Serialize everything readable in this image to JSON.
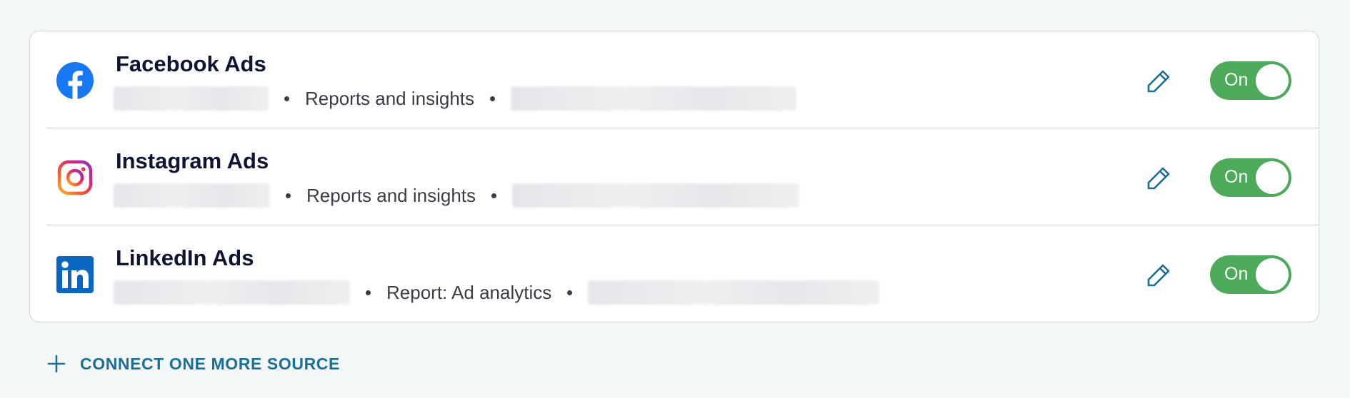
{
  "sources": [
    {
      "name": "Facebook Ads",
      "logo_icon": "facebook-icon",
      "detail": "Reports and insights",
      "toggle_label": "On",
      "toggle_on": true
    },
    {
      "name": "Instagram Ads",
      "logo_icon": "instagram-icon",
      "detail": "Reports and insights",
      "toggle_label": "On",
      "toggle_on": true
    },
    {
      "name": "LinkedIn Ads",
      "logo_icon": "linkedin-icon",
      "detail": "Report: Ad analytics",
      "toggle_label": "On",
      "toggle_on": true
    }
  ],
  "connect_more": {
    "label": "CONNECT ONE MORE SOURCE",
    "icon": "plus-icon"
  },
  "colors": {
    "toggle_on": "#4caa5a",
    "accent": "#1b6e95",
    "facebook": "#1877f2",
    "linkedin": "#0a66c2",
    "title": "#0f1433"
  }
}
